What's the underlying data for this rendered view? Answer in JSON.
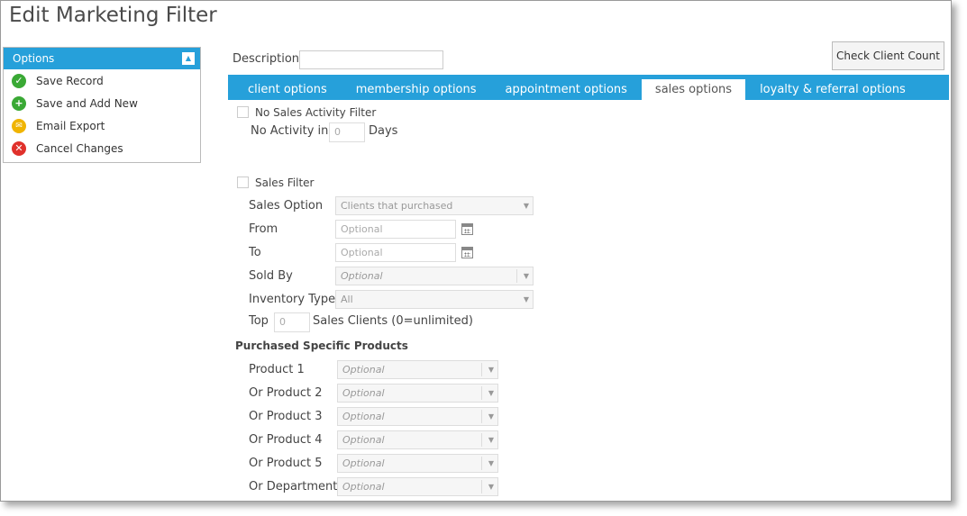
{
  "page": {
    "title": "Edit Marketing Filter"
  },
  "options": {
    "header": "Options",
    "items": [
      {
        "label": "Save Record",
        "icon": "check-circle-icon"
      },
      {
        "label": "Save and Add New",
        "icon": "plus-circle-icon"
      },
      {
        "label": "Email Export",
        "icon": "email-icon"
      },
      {
        "label": "Cancel Changes",
        "icon": "cancel-circle-icon"
      }
    ]
  },
  "description": {
    "label": "Description",
    "value": ""
  },
  "check_client_count_label": "Check Client Count",
  "tabs": [
    {
      "label": "client options"
    },
    {
      "label": "membership options"
    },
    {
      "label": "appointment options"
    },
    {
      "label": "sales options",
      "active": true
    },
    {
      "label": "loyalty & referral options"
    }
  ],
  "no_sales": {
    "checkbox_label": "No Sales Activity Filter",
    "no_activity_label": "No Activity in",
    "days_value": "0",
    "days_label": "Days"
  },
  "sales_filter": {
    "checkbox_label": "Sales Filter",
    "sales_option_label": "Sales Option",
    "sales_option_value": "Clients that purchased",
    "from_label": "From",
    "from_placeholder": "Optional",
    "to_label": "To",
    "to_placeholder": "Optional",
    "sold_by_label": "Sold By",
    "sold_by_placeholder": "Optional",
    "inventory_type_label": "Inventory Type",
    "inventory_type_value": "All",
    "top_label": "Top",
    "top_value": "0",
    "top_suffix": "Sales Clients (0=unlimited)"
  },
  "purchased": {
    "heading": "Purchased Specific Products",
    "rows": [
      {
        "label": "Product 1",
        "placeholder": "Optional"
      },
      {
        "label": "Or Product 2",
        "placeholder": "Optional"
      },
      {
        "label": "Or Product 3",
        "placeholder": "Optional"
      },
      {
        "label": "Or Product 4",
        "placeholder": "Optional"
      },
      {
        "label": "Or Product 5",
        "placeholder": "Optional"
      },
      {
        "label": "Or Department",
        "placeholder": "Optional"
      }
    ]
  },
  "colors": {
    "accent": "#26a0da",
    "green": "#3aa935",
    "yellow": "#f0b400",
    "red": "#e0312b"
  }
}
